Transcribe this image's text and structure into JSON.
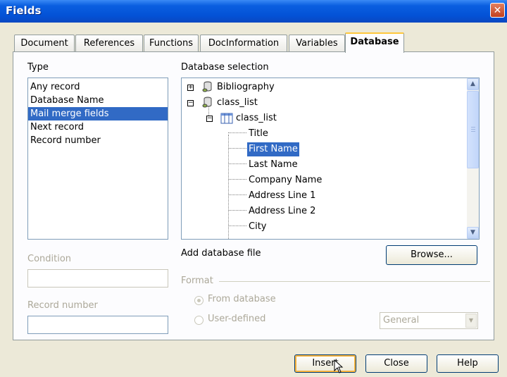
{
  "window": {
    "title": "Fields"
  },
  "tabs": [
    {
      "label": "Document"
    },
    {
      "label": "References"
    },
    {
      "label": "Functions"
    },
    {
      "label": "DocInformation"
    },
    {
      "label": "Variables"
    },
    {
      "label": "Database"
    }
  ],
  "type_panel": {
    "label": "Type",
    "items": [
      "Any record",
      "Database Name",
      "Mail merge fields",
      "Next record",
      "Record number"
    ],
    "selected": "Mail merge fields"
  },
  "database_selection": {
    "label": "Database selection",
    "tree": [
      {
        "label": "Bibliography",
        "icon": "database-icon",
        "expander": "+"
      },
      {
        "label": "class_list",
        "icon": "database-icon",
        "expander": "-"
      },
      {
        "label": "class_list",
        "icon": "table-icon",
        "expander": "-"
      },
      {
        "label": "Title"
      },
      {
        "label": "First Name",
        "selected": true
      },
      {
        "label": "Last Name"
      },
      {
        "label": "Company Name"
      },
      {
        "label": "Address Line 1"
      },
      {
        "label": "Address Line 2"
      },
      {
        "label": "City"
      }
    ]
  },
  "condition": {
    "label": "Condition",
    "value": ""
  },
  "record_number": {
    "label": "Record number",
    "value": ""
  },
  "add_database": {
    "label": "Add database file",
    "browse_label": "Browse..."
  },
  "format": {
    "label": "Format",
    "from_database": "From database",
    "user_defined": "User-defined",
    "combo_value": "General"
  },
  "buttons": {
    "insert": "Insert",
    "close": "Close",
    "help": "Help"
  },
  "colors": {
    "title_bar": "#0351d6",
    "selection": "#316ac5",
    "dialog_bg": "#ece9d8"
  }
}
